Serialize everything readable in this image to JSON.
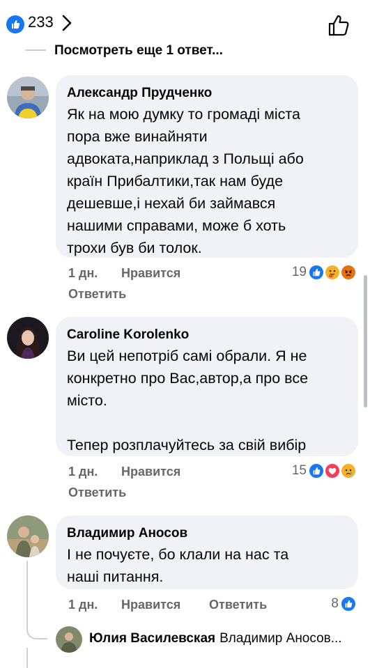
{
  "header": {
    "like_count": "233",
    "icons": [
      "like-icon",
      "chevron-right-icon",
      "thumbs-up-outline-icon"
    ]
  },
  "more_replies_text": "Посмотреть еще 1 ответ...",
  "comments": [
    {
      "author": "Александр Прудченко",
      "text": "Як на мою думку то громаді міста\nпора вже винайняти\nадвоката,наприклад з Польщі або\nкраїн Прибалтики,так нам буде\nдешевше,і нехай би займався\nнашими справами, може б хоть\nтрохи був би толок.",
      "time": "1 дн.",
      "like_label": "Нравится",
      "reply_label": "Ответить",
      "reaction_count": "19",
      "reactions": [
        "like",
        "care",
        "angry"
      ]
    },
    {
      "author": "Caroline Korolenko",
      "text": "Ви цей непотріб самі обрали. Я не\nконкретно про Вас,автор,а про все\nмісто.\n\nТепер розплачуйтесь за свій вибір",
      "time": "1 дн.",
      "like_label": "Нравится",
      "reply_label": "Ответить",
      "reaction_count": "15",
      "reactions": [
        "like",
        "love",
        "sad"
      ]
    },
    {
      "author": "Владимир Аносов",
      "text": "І не почуєте, бо клали на нас та\nнаші питання.",
      "time": "1 дн.",
      "like_label": "Нравится",
      "reply_label": "Ответить",
      "reaction_count": "8",
      "reactions": [
        "like"
      ]
    }
  ],
  "reply_preview": {
    "author": "Юлия Василевская",
    "snippet": "Владимир Аносов..."
  },
  "colors": {
    "facebook_blue": "#1877f2",
    "bubble_bg": "#f0f2f5",
    "secondary_text": "#65676b"
  }
}
